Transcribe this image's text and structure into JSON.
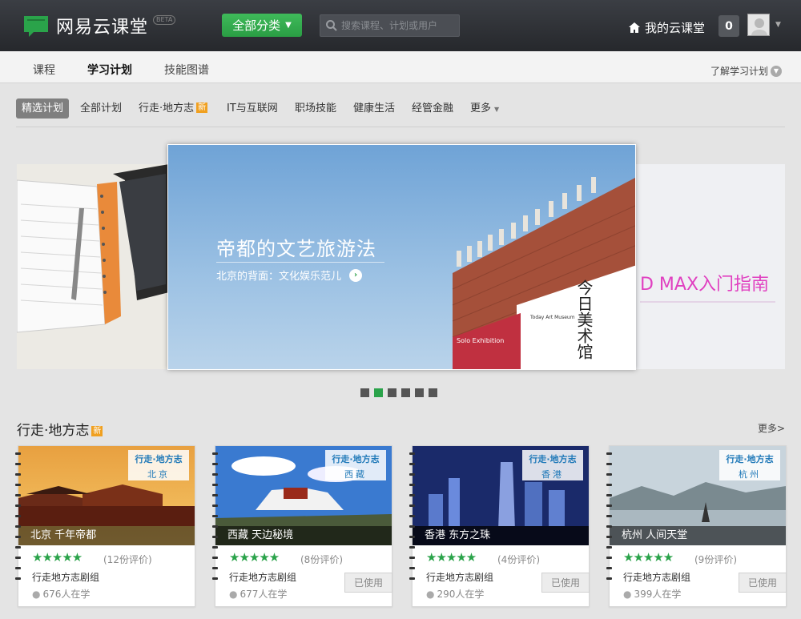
{
  "header": {
    "brand": "网易云课堂",
    "beta": "BETA",
    "all_categories": "全部分类",
    "search_placeholder": "搜索课程、计划或用户",
    "my_classroom": "我的云课堂",
    "notif_count": "0"
  },
  "subnav": {
    "tabs": [
      "课程",
      "学习计划",
      "技能图谱"
    ],
    "active": "学习计划",
    "learn_more": "了解学习计划"
  },
  "filters": {
    "items": [
      "精选计划",
      "全部计划",
      "行走·地方志",
      "IT与互联网",
      "职场技能",
      "健康生活",
      "经管金融",
      "更多"
    ],
    "new_badge": "新",
    "selected": "精选计划"
  },
  "carousel": {
    "title": "帝都的文艺旅游法",
    "subtitle": "北京的背面：文化娱乐范儿",
    "right_text": "D MAX入门指南",
    "building_sign": "今日美术馆",
    "building_sign_en": "Today Art Museum",
    "banner_left": "Solo Exhibition",
    "dots_count": 6,
    "active_dot": 2
  },
  "section": {
    "title": "行走·地方志",
    "new_badge": "新",
    "more": "更多>"
  },
  "cards": [
    {
      "tag": "行走·地方志",
      "place": "北京",
      "caption": "北京  千年帝都",
      "stars": "★★★★★",
      "reviews": "(12份评价)",
      "group": "行走地方志剧组",
      "learners": "676人在学",
      "used": ""
    },
    {
      "tag": "行走·地方志",
      "place": "西藏",
      "caption": "西藏  天边秘境",
      "stars": "★★★★★",
      "reviews": "(8份评价)",
      "group": "行走地方志剧组",
      "learners": "677人在学",
      "used": "已使用"
    },
    {
      "tag": "行走·地方志",
      "place": "香港",
      "caption": "香港  东方之珠",
      "stars": "★★★★★",
      "reviews": "(4份评价)",
      "group": "行走地方志剧组",
      "learners": "290人在学",
      "used": "已使用"
    },
    {
      "tag": "行走·地方志",
      "place": "杭州",
      "caption": "杭州  人间天堂",
      "stars": "★★★★★",
      "reviews": "(9份评价)",
      "group": "行走地方志剧组",
      "learners": "399人在学",
      "used": "已使用"
    }
  ],
  "colors": {
    "brand_green": "#2aa34a",
    "header_bg": "#2e3035",
    "tag_blue": "#1e78b8"
  }
}
